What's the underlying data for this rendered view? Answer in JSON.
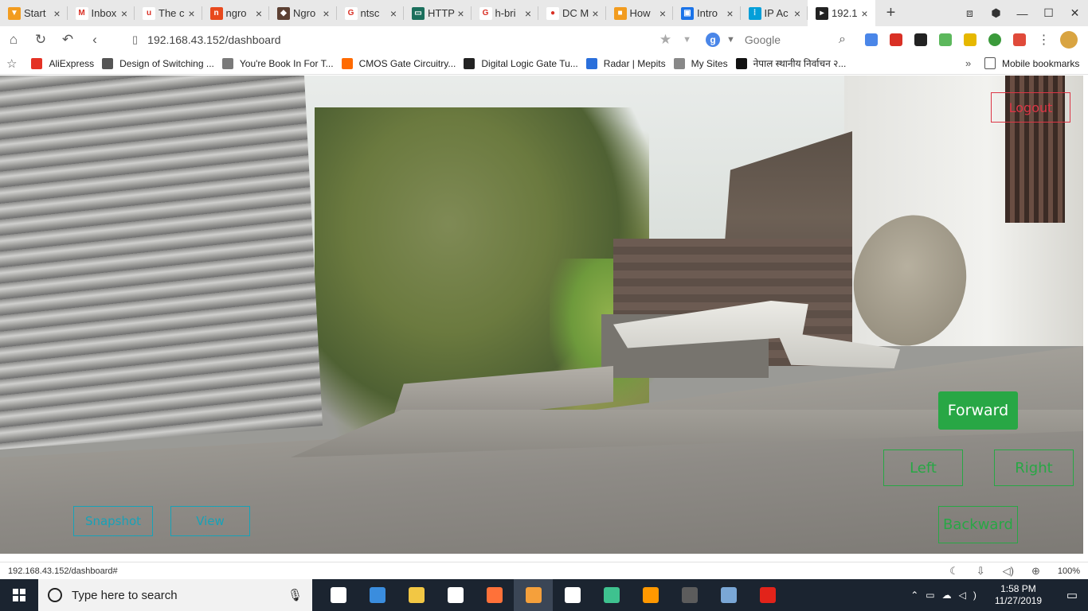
{
  "browser": {
    "tabs": [
      {
        "title": "Start",
        "color": "#f29c1f",
        "glyph": "▼"
      },
      {
        "title": "Inbox",
        "color": "#ffffff",
        "glyph": "M"
      },
      {
        "title": "The c",
        "color": "#ffffff",
        "glyph": "u"
      },
      {
        "title": "ngro",
        "color": "#e8491d",
        "glyph": "n"
      },
      {
        "title": "Ngro",
        "color": "#5c4033",
        "glyph": "◆"
      },
      {
        "title": "ntsc",
        "color": "#ffffff",
        "glyph": "G"
      },
      {
        "title": "HTTP",
        "color": "#1b6f5c",
        "glyph": "▭"
      },
      {
        "title": "h-bri",
        "color": "#ffffff",
        "glyph": "G"
      },
      {
        "title": "DC M",
        "color": "#ffffff",
        "glyph": "●"
      },
      {
        "title": "How",
        "color": "#f29c1f",
        "glyph": "■"
      },
      {
        "title": "Intro",
        "color": "#1a73e8",
        "glyph": "▣"
      },
      {
        "title": "IP Ac",
        "color": "#049fd9",
        "glyph": "⁞"
      },
      {
        "title": "192.1",
        "color": "#222222",
        "glyph": "▸",
        "active": true
      }
    ],
    "new_tab_icon": "+",
    "window_controls": [
      "⧈",
      "⬢",
      "—",
      "☐",
      "✕"
    ],
    "url": "192.168.43.152/dashboard",
    "search_engine": "Google",
    "bookmarks": [
      {
        "label": "AliExpress",
        "color": "#e43225"
      },
      {
        "label": "Design of Switching ...",
        "color": "#555555"
      },
      {
        "label": "You're Book In For T...",
        "color": "#7a7a7a"
      },
      {
        "label": "CMOS Gate Circuitry...",
        "color": "#ff6a00"
      },
      {
        "label": "Digital Logic Gate Tu...",
        "color": "#222222"
      },
      {
        "label": "Radar | Mepits",
        "color": "#2a6fdb"
      },
      {
        "label": "My Sites",
        "color": "#888888"
      },
      {
        "label": "नेपाल स्थानीय निर्वाचन २...",
        "color": "#111111"
      }
    ],
    "bookmarks_more": "»",
    "mobile_bookmarks": "Mobile bookmarks",
    "status_url": "192.168.43.152/dashboard#",
    "zoom": "100%"
  },
  "dashboard": {
    "logout": "Logout",
    "forward": "Forward",
    "left": "Left",
    "right": "Right",
    "backward": "Backward",
    "snapshot": "Snapshot",
    "view": "View"
  },
  "taskbar": {
    "search_placeholder": "Type here to search",
    "apps": [
      {
        "name": "task-view",
        "color": "#ffffff"
      },
      {
        "name": "settings",
        "color": "#3a8dde"
      },
      {
        "name": "file-explorer",
        "color": "#f2c744"
      },
      {
        "name": "store",
        "color": "#ffffff"
      },
      {
        "name": "firefox",
        "color": "#ff7139"
      },
      {
        "name": "app-orange",
        "color": "#f5a03b"
      },
      {
        "name": "mail",
        "color": "#ffffff"
      },
      {
        "name": "app-green",
        "color": "#3ec28f"
      },
      {
        "name": "sublime",
        "color": "#ff9800"
      },
      {
        "name": "app-game",
        "color": "#5c5c5c"
      },
      {
        "name": "app-tool",
        "color": "#7aa7d6"
      },
      {
        "name": "acrobat",
        "color": "#e2231a"
      }
    ],
    "time": "1:58 PM",
    "date": "11/27/2019"
  }
}
